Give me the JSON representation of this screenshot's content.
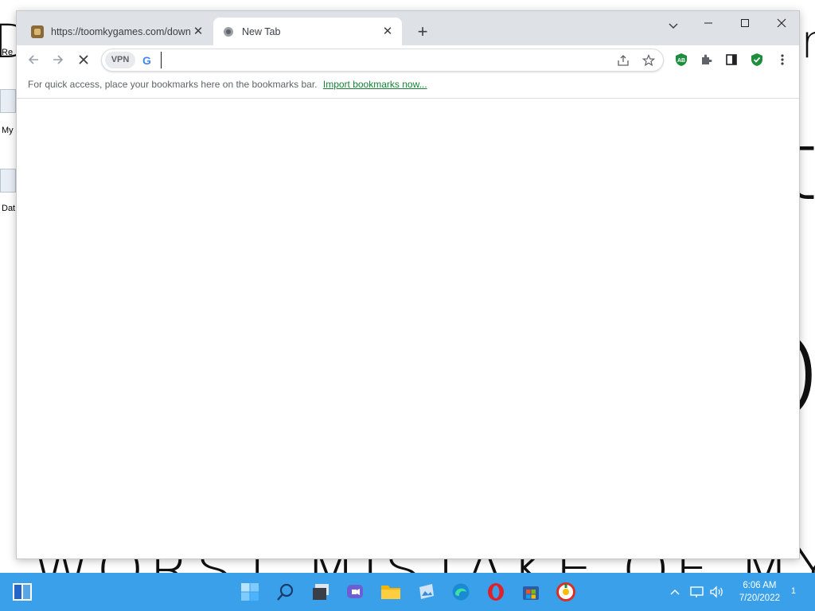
{
  "desktop": {
    "wallpaper_top_left": "De",
    "wallpaper_top_right": "r",
    "wallpaper_right_a": "t",
    "wallpaper_right_b": "O",
    "wallpaper_bottom": "WORST MISTAKE OF MY LIFE",
    "icon_labels": [
      "Re",
      "My",
      "Dat"
    ]
  },
  "browser": {
    "tabs": [
      {
        "title": "https://toomkygames.com/down",
        "icon": "game-favicon",
        "active": false
      },
      {
        "title": "New Tab",
        "icon": "newtab-favicon",
        "active": true
      }
    ],
    "new_tab_label": "+",
    "omnibox": {
      "vpn_label": "VPN",
      "search_engine_icon": "G",
      "value": "",
      "placeholder": ""
    },
    "bookmarks_bar": {
      "message": "For quick access, place your bookmarks here on the bookmarks bar.",
      "link": "Import bookmarks now..."
    },
    "extensions": [
      "adblock-icon",
      "extensions-puzzle-icon",
      "side-panel-icon",
      "shield-check-icon",
      "menu-kebab-icon"
    ]
  },
  "taskbar": {
    "time": "6:06 AM",
    "date": "7/20/2022",
    "notification_count": "1",
    "pinned": [
      "start",
      "widgets",
      "search",
      "task-view",
      "teams",
      "file-explorer",
      "photos",
      "edge",
      "opera",
      "store",
      "brave"
    ]
  },
  "colors": {
    "taskbar": "#3aa0ea",
    "tabstrip": "#dee1e6",
    "link": "#188038"
  }
}
